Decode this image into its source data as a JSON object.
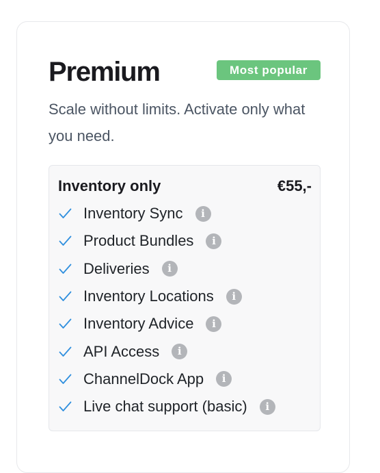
{
  "plan": {
    "title": "Premium",
    "badge": "Most popular",
    "description": "Scale without limits. Activate only what you need."
  },
  "option": {
    "name": "Inventory only",
    "price": "€55,-"
  },
  "features": [
    {
      "label": "Inventory Sync",
      "check_icon": "checkmark-icon",
      "info_icon": "info-icon",
      "info_glyph": "i"
    },
    {
      "label": "Product Bundles",
      "check_icon": "checkmark-icon",
      "info_icon": "info-icon",
      "info_glyph": "i"
    },
    {
      "label": "Deliveries",
      "check_icon": "checkmark-icon",
      "info_icon": "info-icon",
      "info_glyph": "i"
    },
    {
      "label": "Inventory Locations",
      "check_icon": "checkmark-icon",
      "info_icon": "info-icon",
      "info_glyph": "i"
    },
    {
      "label": "Inventory Advice",
      "check_icon": "checkmark-icon",
      "info_icon": "info-icon",
      "info_glyph": "i"
    },
    {
      "label": "API Access",
      "check_icon": "checkmark-icon",
      "info_icon": "info-icon",
      "info_glyph": "i"
    },
    {
      "label": "ChannelDock App",
      "check_icon": "checkmark-icon",
      "info_icon": "info-icon",
      "info_glyph": "i"
    },
    {
      "label": "Live chat support (basic)",
      "check_icon": "checkmark-icon",
      "info_icon": "info-icon",
      "info_glyph": "i"
    }
  ],
  "colors": {
    "badge_bg": "#6bc57e",
    "check": "#2f8fde",
    "info_bg": "#b3b5b9"
  }
}
